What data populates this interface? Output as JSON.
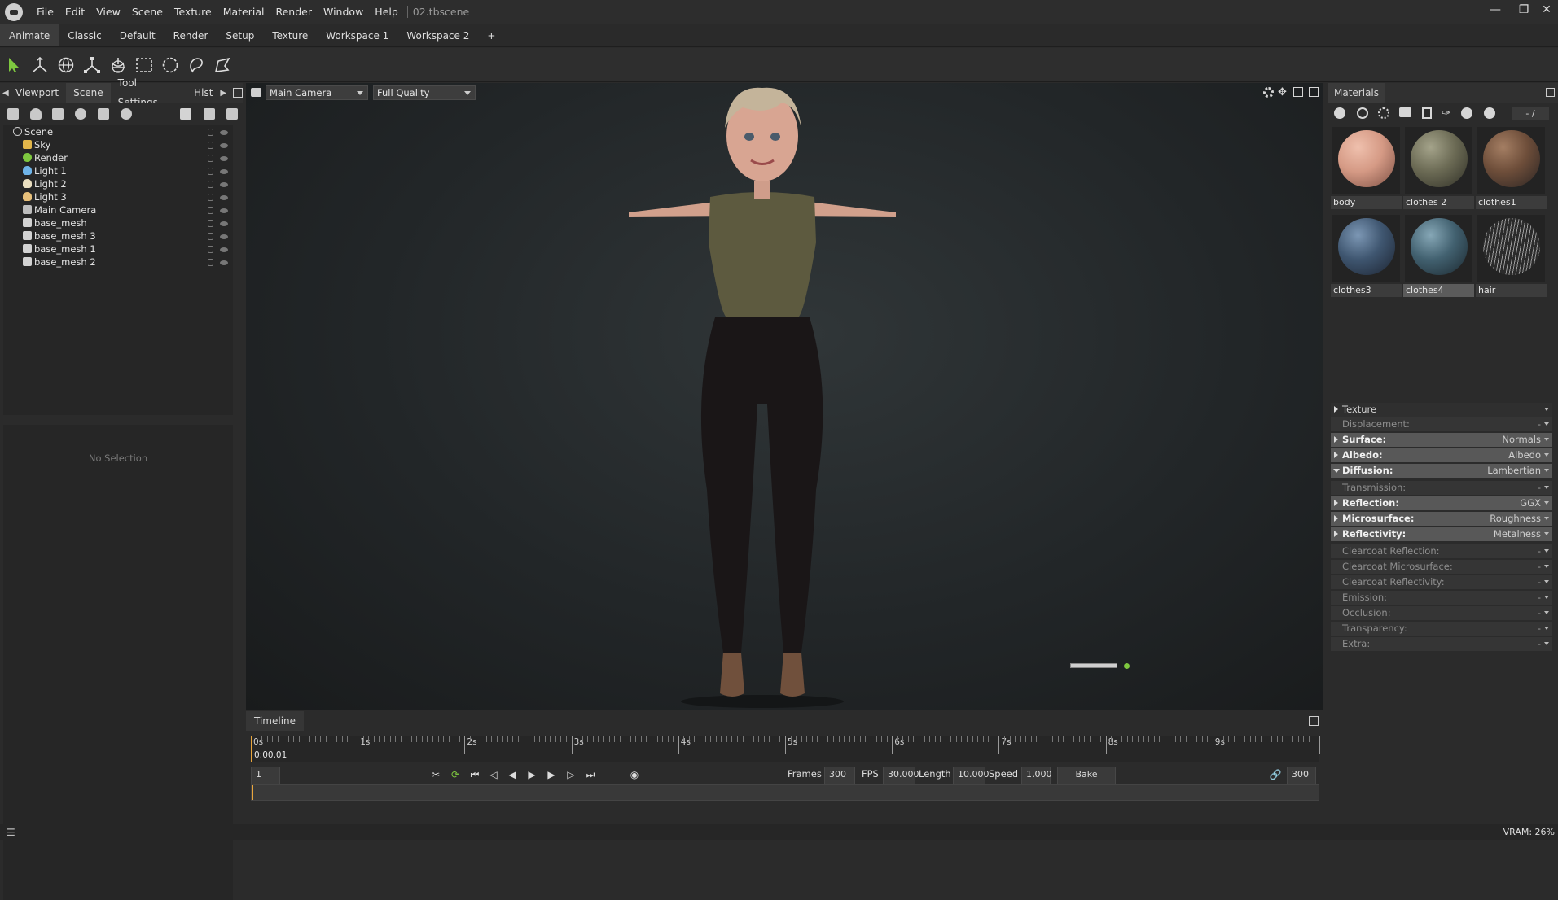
{
  "menubar": {
    "items": [
      "File",
      "Edit",
      "View",
      "Scene",
      "Texture",
      "Material",
      "Render",
      "Window",
      "Help"
    ],
    "filename": "02.tbscene"
  },
  "workspace_tabs": [
    "Animate",
    "Classic",
    "Default",
    "Render",
    "Setup",
    "Texture",
    "Workspace 1",
    "Workspace 2",
    "+"
  ],
  "toolbar": {
    "tools": [
      "select-arrow-icon",
      "transform-icon",
      "rotate-icon",
      "scale-icon",
      "world-icon",
      "rect-select-icon",
      "lasso-circle-icon",
      "lasso-icon",
      "polygon-select-icon"
    ]
  },
  "left_panel": {
    "tabs": [
      "Viewport",
      "Scene",
      "Tool Settings",
      "Hist"
    ],
    "active_tab": "Scene",
    "tree": [
      {
        "label": "Scene",
        "icon": "scene-icon",
        "indent": 0
      },
      {
        "label": "Sky",
        "icon": "sky-icon",
        "indent": 1
      },
      {
        "label": "Render",
        "icon": "render-icon",
        "indent": 1
      },
      {
        "label": "Light 1",
        "icon": "light-icon",
        "indent": 1
      },
      {
        "label": "Light 2",
        "icon": "light-icon",
        "indent": 1
      },
      {
        "label": "Light 3",
        "icon": "light-icon",
        "indent": 1
      },
      {
        "label": "Main Camera",
        "icon": "camera-icon",
        "indent": 1
      },
      {
        "label": "base_mesh",
        "icon": "mesh-icon",
        "indent": 1
      },
      {
        "label": "base_mesh 3",
        "icon": "mesh-icon",
        "indent": 1
      },
      {
        "label": "base_mesh 1",
        "icon": "mesh-icon",
        "indent": 1
      },
      {
        "label": "base_mesh 2",
        "icon": "mesh-icon",
        "indent": 1
      }
    ],
    "no_selection": "No Selection"
  },
  "viewport": {
    "camera": "Main Camera",
    "quality": "Full Quality"
  },
  "timeline": {
    "title": "Timeline",
    "ticks": [
      "0s",
      "1s",
      "2s",
      "3s",
      "4s",
      "5s",
      "6s",
      "7s",
      "8s",
      "9s"
    ],
    "current_time": "0:00.01",
    "frame_field": "1",
    "frames_label": "Frames",
    "frames_value": "300",
    "fps_label": "FPS",
    "fps_value": "30.000",
    "length_label": "Length",
    "length_value": "10.000",
    "speed_label": "Speed",
    "speed_value": "1.000",
    "bake_speed": "Bake Speed",
    "end_frame": "300"
  },
  "right_panel": {
    "title": "Materials",
    "counter": "- /",
    "materials": [
      {
        "name": "body",
        "color": "#d59a85"
      },
      {
        "name": "clothes 2",
        "color": "#6c6b55"
      },
      {
        "name": "clothes1",
        "color": "#6e4e3a"
      },
      {
        "name": "clothes3",
        "color": "#3f5670"
      },
      {
        "name": "clothes4",
        "color": "#426170",
        "selected": true
      },
      {
        "name": "hair",
        "color": "#2b2b2b"
      }
    ],
    "texture_header": "Texture",
    "properties": [
      {
        "label": "Displacement:",
        "value": "-",
        "style": "dim"
      },
      {
        "label": "Surface:",
        "value": "Normals",
        "style": "bold"
      },
      {
        "label": "Albedo:",
        "value": "Albedo",
        "style": "bold"
      },
      {
        "label": "Diffusion:",
        "value": "Lambertian",
        "style": "bold",
        "open": true
      },
      {
        "label": "Transmission:",
        "value": "-",
        "style": "dim"
      },
      {
        "label": "Reflection:",
        "value": "GGX",
        "style": "bold"
      },
      {
        "label": "Microsurface:",
        "value": "Roughness",
        "style": "bold"
      },
      {
        "label": "Reflectivity:",
        "value": "Metalness",
        "style": "bold"
      },
      {
        "label": "Clearcoat Reflection:",
        "value": "-",
        "style": "dim"
      },
      {
        "label": "Clearcoat Microsurface:",
        "value": "-",
        "style": "dim"
      },
      {
        "label": "Clearcoat Reflectivity:",
        "value": "-",
        "style": "dim"
      },
      {
        "label": "Emission:",
        "value": "-",
        "style": "dim"
      },
      {
        "label": "Occlusion:",
        "value": "-",
        "style": "dim"
      },
      {
        "label": "Transparency:",
        "value": "-",
        "style": "dim"
      },
      {
        "label": "Extra:",
        "value": "-",
        "style": "dim"
      }
    ]
  },
  "statusbar": {
    "vram": "VRAM: 26%"
  },
  "colors": {
    "accent_green": "#7ec83f",
    "viewport_bg": "#222628"
  }
}
